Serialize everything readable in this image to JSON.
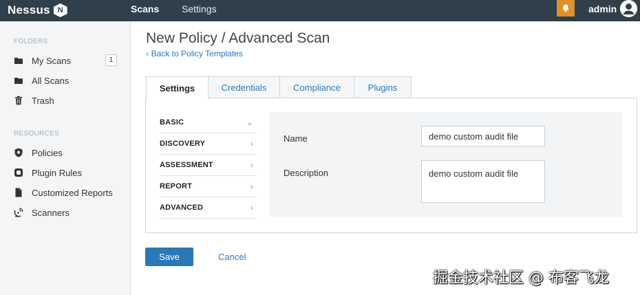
{
  "app": {
    "logo_text": "Nessus",
    "logo_badge": "N"
  },
  "topnav": {
    "scans": "Scans",
    "settings": "Settings",
    "username": "admin",
    "bell_icon": "bell-icon",
    "avatar_icon": "user-avatar-icon",
    "accent_bell": "#e08f2a"
  },
  "sidebar": {
    "folders_title": "FOLDERS",
    "resources_title": "RESOURCES",
    "folders": [
      {
        "label": "My Scans",
        "icon": "folder-icon",
        "count": "1"
      },
      {
        "label": "All Scans",
        "icon": "folder-icon"
      },
      {
        "label": "Trash",
        "icon": "trash-icon"
      }
    ],
    "resources": [
      {
        "label": "Policies",
        "icon": "shield-icon"
      },
      {
        "label": "Plugin Rules",
        "icon": "plugin-icon"
      },
      {
        "label": "Customized Reports",
        "icon": "document-icon"
      },
      {
        "label": "Scanners",
        "icon": "satellite-icon"
      }
    ]
  },
  "main": {
    "title": "New Policy / Advanced Scan",
    "back_link": "Back to Policy Templates",
    "tabs": [
      {
        "label": "Settings",
        "active": true
      },
      {
        "label": "Credentials"
      },
      {
        "label": "Compliance"
      },
      {
        "label": "Plugins"
      }
    ],
    "subnav": [
      {
        "label": "BASIC",
        "expanded": true
      },
      {
        "label": "DISCOVERY"
      },
      {
        "label": "ASSESSMENT"
      },
      {
        "label": "REPORT"
      },
      {
        "label": "ADVANCED"
      }
    ],
    "form": {
      "name_label": "Name",
      "name_value": "demo custom audit file",
      "description_label": "Description",
      "description_value": "demo custom audit file"
    },
    "save_label": "Save",
    "cancel_label": "Cancel"
  },
  "watermark": "掘金技术社区 @ 布客飞龙",
  "colors": {
    "topbar": "#2f3f4c",
    "link": "#2a78b8",
    "primary_button": "#2a78b8"
  }
}
